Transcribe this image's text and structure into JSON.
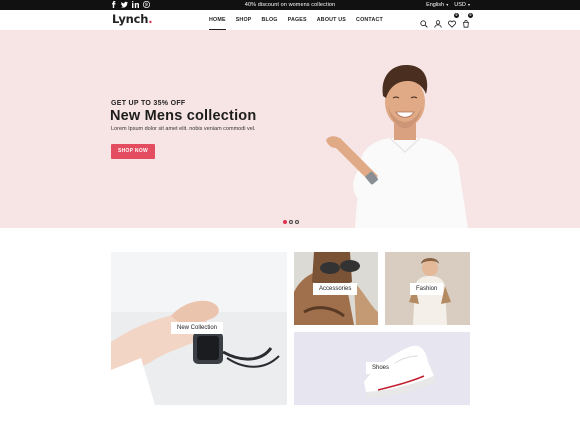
{
  "topbar": {
    "social_icons": [
      "facebook-icon",
      "twitter-icon",
      "linkedin-icon",
      "pinterest-icon"
    ],
    "promo_text": "40% discount on womens collection",
    "language": "English",
    "currency": "USD"
  },
  "header": {
    "logo_text": "Lynch",
    "logo_dot": ".",
    "nav": [
      "HOME",
      "SHOP",
      "BLOG",
      "PAGES",
      "ABOUT US",
      "CONTACT"
    ],
    "active_nav": "HOME",
    "icons": [
      "search-icon",
      "user-icon",
      "heart-icon",
      "cart-icon"
    ],
    "wishlist_count": "0",
    "cart_count": "0"
  },
  "hero": {
    "kicker": "GET UP TO 35% OFF",
    "title": "New Mens collection",
    "subtitle": "Lorem Ipsum dolor sit amet elit. nobis veniam commodi vel.",
    "button": "SHOP NOW",
    "slides": 3,
    "active_slide": 1
  },
  "collections": [
    {
      "label": "New Collection"
    },
    {
      "label": "Accessories"
    },
    {
      "label": "Fashion"
    },
    {
      "label": "Shoes"
    }
  ],
  "colors": {
    "accent": "#e0334f",
    "button": "#e34d5f",
    "hero_bg": "#f7e4e5",
    "topbar_bg": "#111111"
  }
}
